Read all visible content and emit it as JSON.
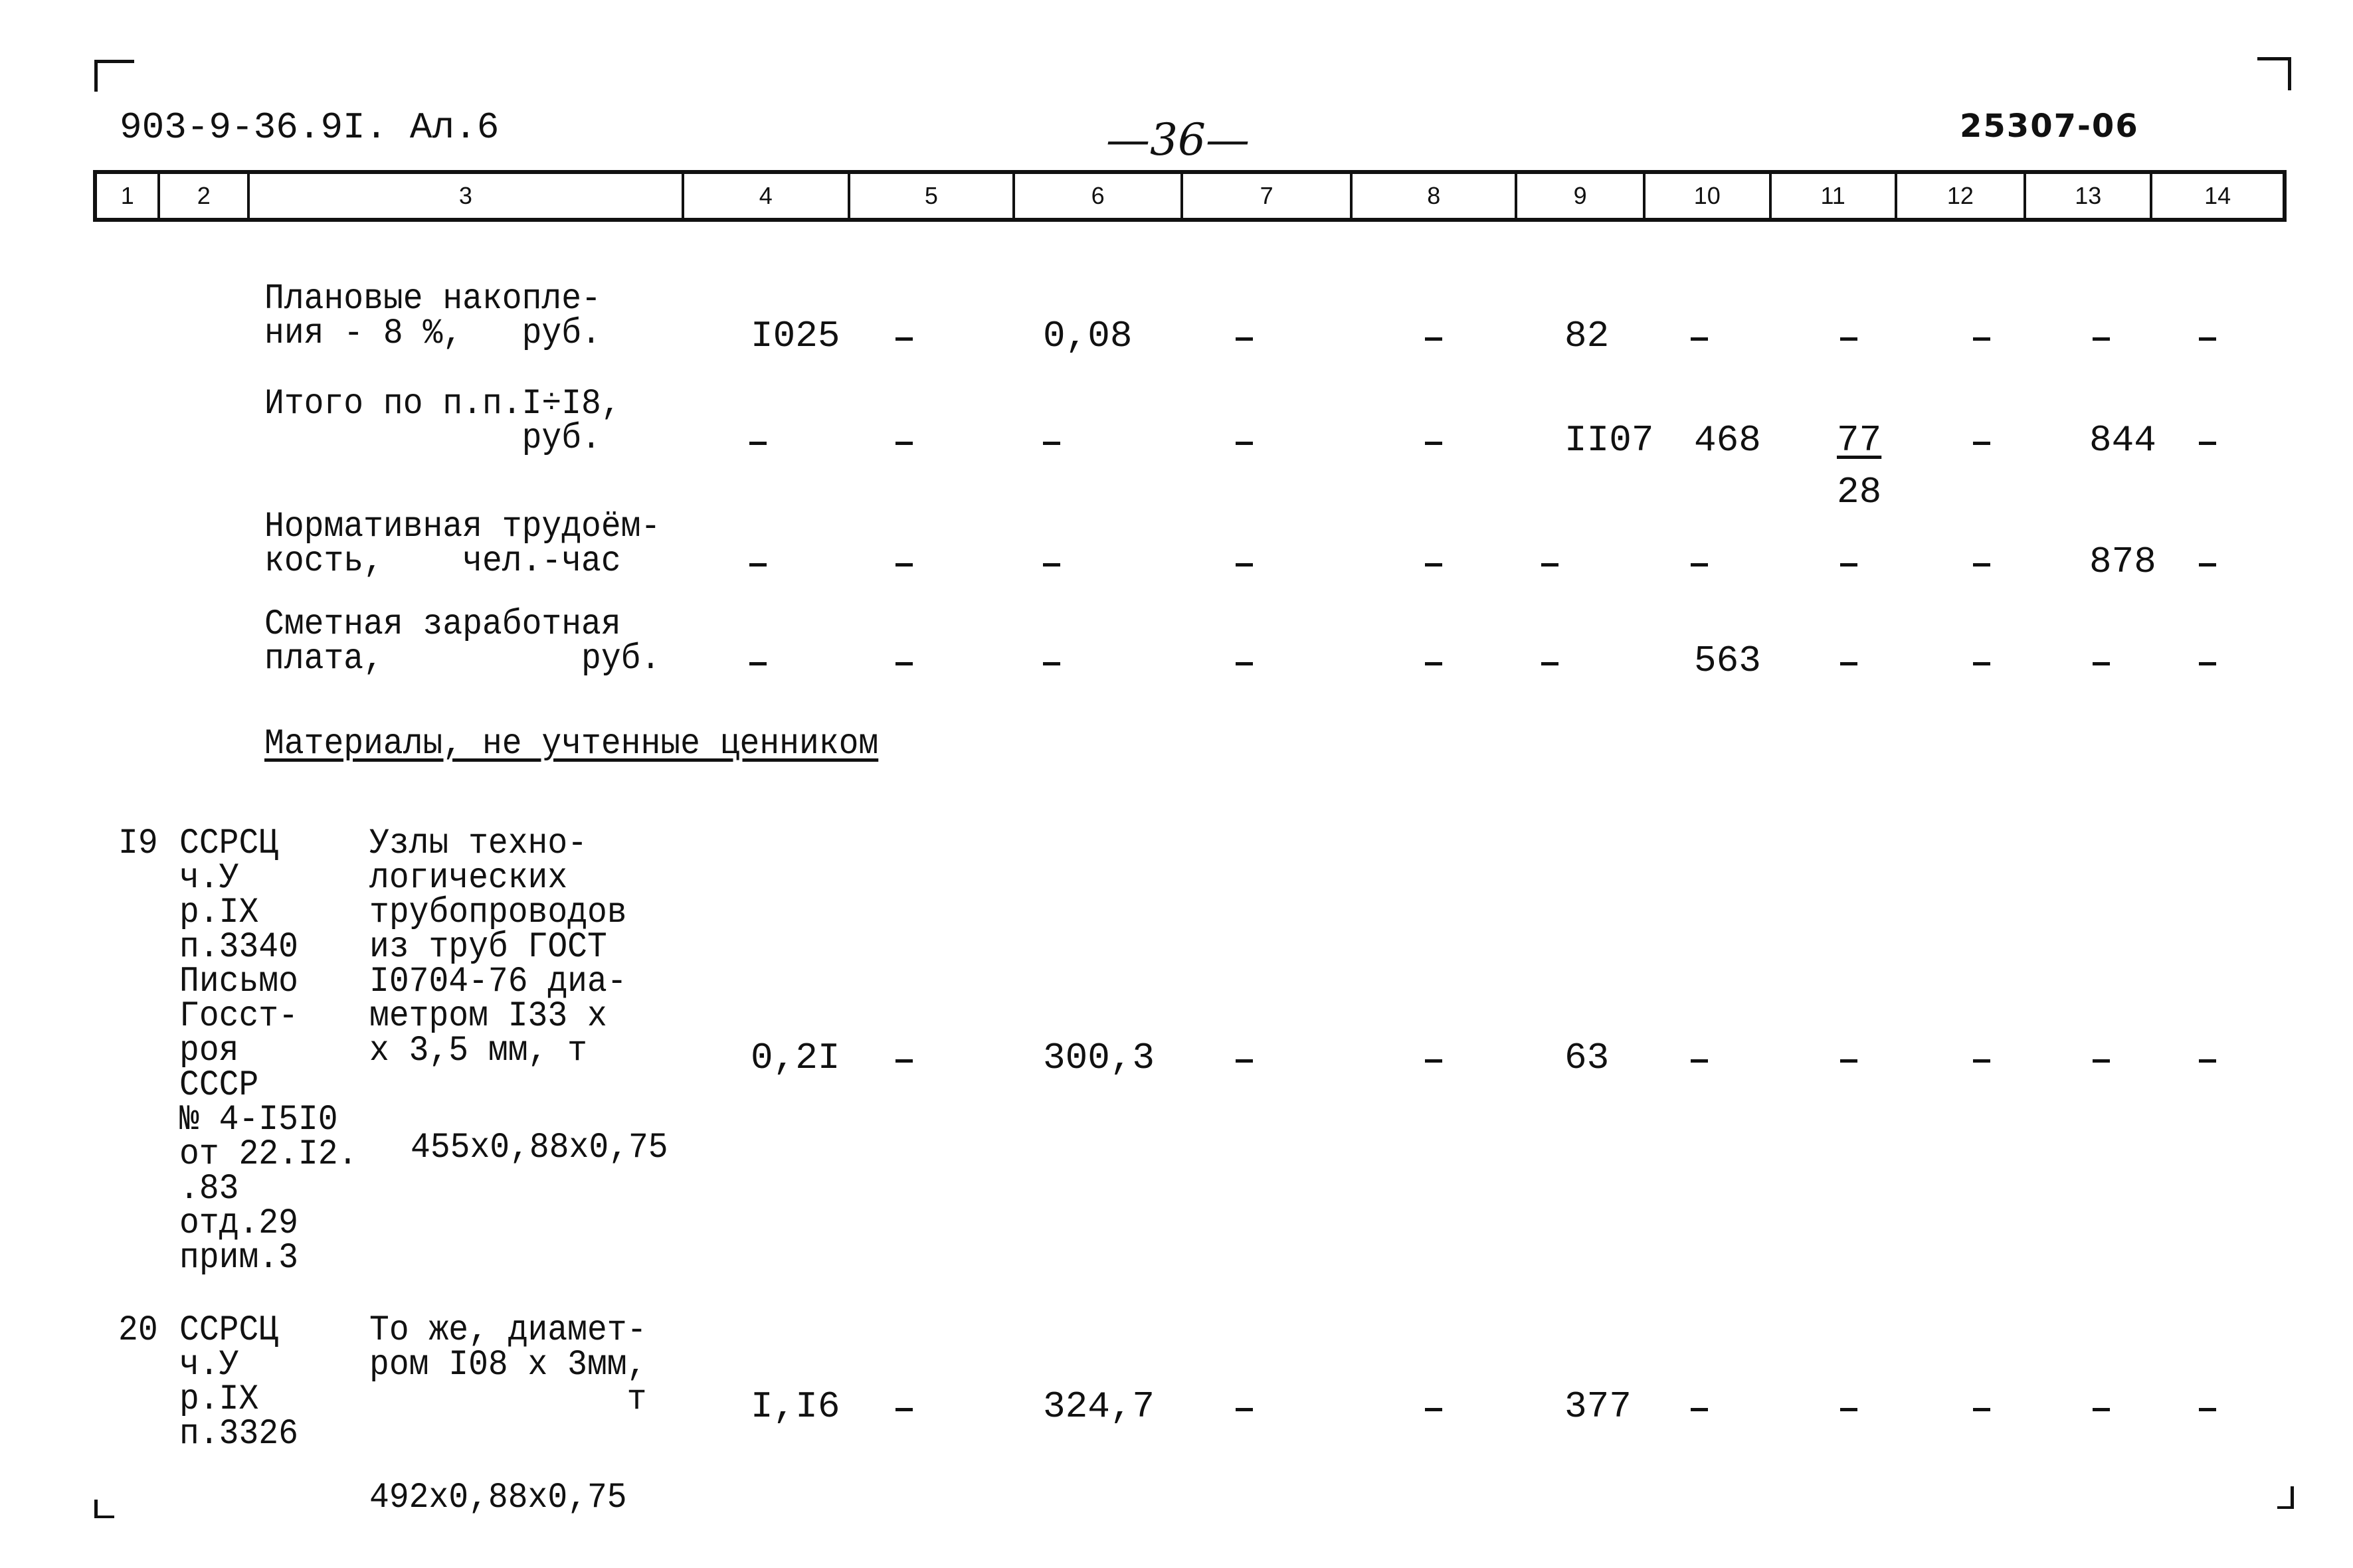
{
  "header": {
    "doc_code": "903-9-36.9I. Ал.6",
    "page_number": "—36—",
    "stamp": "25307-06"
  },
  "columns": [
    "1",
    "2",
    "3",
    "4",
    "5",
    "6",
    "7",
    "8",
    "9",
    "10",
    "11",
    "12",
    "13",
    "14"
  ],
  "summary_rows": [
    {
      "label_lines": [
        "Плановые накопле-",
        "ния - 8 %,   руб."
      ],
      "c4": "I025",
      "c5": "–",
      "c6": "0,08",
      "c7": "–",
      "c8": "–",
      "c9": "82",
      "c10": "–",
      "c11": "–",
      "c12": "–",
      "c13": "–",
      "c14": "–"
    },
    {
      "label_lines": [
        "Итого по п.п.I÷I8,",
        "             руб."
      ],
      "c4": "–",
      "c5": "–",
      "c6": "–",
      "c7": "–",
      "c8": "–",
      "c9": "II07",
      "c10": "468",
      "c11": "77",
      "c11_sub": "28",
      "c12": "–",
      "c13": "844",
      "c14": "–"
    },
    {
      "label_lines": [
        "Нормативная трудоём-",
        "кость,    чел.-час"
      ],
      "c4": "–",
      "c5": "–",
      "c6": "–",
      "c7": "–",
      "c8": "–",
      "c9": "–",
      "c10": "–",
      "c11": "–",
      "c12": "–",
      "c13": "878",
      "c14": "–"
    },
    {
      "label_lines": [
        "Сметная заработная",
        "плата,          руб."
      ],
      "c4": "–",
      "c5": "–",
      "c6": "–",
      "c7": "–",
      "c8": "–",
      "c9": "–",
      "c10": "563",
      "c11": "–",
      "c12": "–",
      "c13": "–",
      "c14": "–"
    }
  ],
  "section_title": "Материалы, не учтенные ценником",
  "items": [
    {
      "no": "I9",
      "ref_lines": [
        "ССРСЦ",
        "ч.У",
        "р.IX",
        "п.3340",
        "Письмо",
        "Госст-",
        "роя",
        "СССР",
        "№ 4-I5I0",
        "от 22.I2.",
        ".83",
        "отд.29",
        "прим.3"
      ],
      "desc_lines": [
        "Узлы техно-",
        "логических",
        "трубопроводов",
        "из труб ГОСТ",
        "I0704-76 диа-",
        "метром I33 х",
        "х 3,5 мм, т"
      ],
      "calc": "455х0,88х0,75",
      "c4": "0,2I",
      "c5": "–",
      "c6": "300,3",
      "c7": "–",
      "c8": "–",
      "c9": "63",
      "c10": "–",
      "c11": "–",
      "c12": "–",
      "c13": "–",
      "c14": "–"
    },
    {
      "no": "20",
      "ref_lines": [
        "ССРСЦ",
        "ч.У",
        "р.IX",
        "п.3326"
      ],
      "desc_lines": [
        "То же, диамет-",
        "ром I08 х 3мм,",
        "             т"
      ],
      "calc": "492х0,88х0,75",
      "c4": "I,I6",
      "c5": "–",
      "c6": "324,7",
      "c7": "–",
      "c8": "–",
      "c9": "377",
      "c10": "–",
      "c11": "–",
      "c12": "–",
      "c13": "–",
      "c14": "–"
    }
  ]
}
